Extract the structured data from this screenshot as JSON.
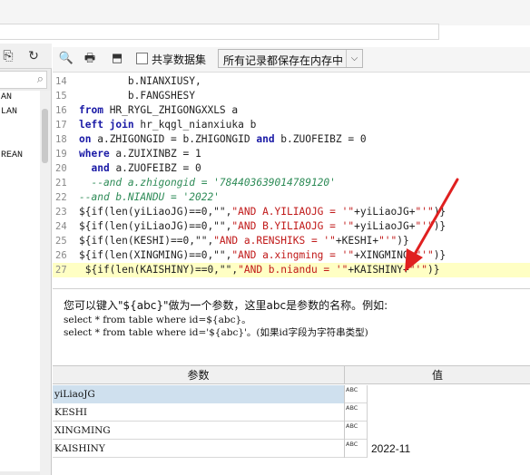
{
  "top_toolbar": {
    "left_icons": [
      {
        "name": "format-icon",
        "glyph": "⎘"
      },
      {
        "name": "refresh-icon",
        "glyph": "↻"
      }
    ],
    "search_icon": "⌕"
  },
  "left_list": {
    "items": [
      "AN",
      "LAN",
      "",
      "",
      "REAN"
    ]
  },
  "editor_toolbar": {
    "icons": [
      {
        "name": "preview-icon",
        "glyph": "🔍"
      },
      {
        "name": "print-icon",
        "glyph": "🖶"
      },
      {
        "name": "export-icon",
        "glyph": "⬒"
      }
    ],
    "share_label": "共享数据集",
    "storage_select": "所有记录都保存在内存中",
    "select_arrow": "⌵"
  },
  "editor": {
    "lines": [
      {
        "n": "14",
        "tokens": [
          {
            "t": "        b.NIANXIUSY,",
            "c": ""
          }
        ]
      },
      {
        "n": "15",
        "tokens": [
          {
            "t": "        b.FANGSHESY",
            "c": ""
          }
        ]
      },
      {
        "n": "16",
        "tokens": [
          {
            "t": "from",
            "c": "kw"
          },
          {
            "t": " HR_RYGL_ZHIGONGXXLS a",
            "c": ""
          }
        ]
      },
      {
        "n": "17",
        "tokens": [
          {
            "t": "left join",
            "c": "kw"
          },
          {
            "t": " hr_kqgl_nianxiuka b",
            "c": ""
          }
        ]
      },
      {
        "n": "18",
        "tokens": [
          {
            "t": "on",
            "c": "kw"
          },
          {
            "t": " a.ZHIGONGID = b.ZHIGONGID ",
            "c": ""
          },
          {
            "t": "and",
            "c": "kw"
          },
          {
            "t": " b.ZUOFEIBZ = 0",
            "c": ""
          }
        ]
      },
      {
        "n": "19",
        "tokens": [
          {
            "t": "where",
            "c": "kw"
          },
          {
            "t": " a.ZUIXINBZ = 1",
            "c": ""
          }
        ]
      },
      {
        "n": "20",
        "tokens": [
          {
            "t": "  ",
            "c": ""
          },
          {
            "t": "and",
            "c": "kw"
          },
          {
            "t": " a.ZUOFEIBZ = 0",
            "c": ""
          }
        ]
      },
      {
        "n": "21",
        "tokens": [
          {
            "t": "  --and a.zhigongid = '784403639014789120'",
            "c": "cm"
          }
        ]
      },
      {
        "n": "22",
        "tokens": [
          {
            "t": "--and b.NIANDU = '2022'",
            "c": "cm"
          }
        ]
      },
      {
        "n": "23",
        "tokens": [
          {
            "t": "${if(len(yiLiaoJG)==0,\"\",",
            "c": ""
          },
          {
            "t": "\"AND A.YILIAOJG = '\"",
            "c": "st"
          },
          {
            "t": "+yiLiaoJG+",
            "c": ""
          },
          {
            "t": "\"'\"",
            "c": "st"
          },
          {
            "t": ")}",
            "c": ""
          }
        ]
      },
      {
        "n": "24",
        "tokens": [
          {
            "t": "${if(len(yiLiaoJG)==0,\"\",",
            "c": ""
          },
          {
            "t": "\"AND B.YILIAOJG = '\"",
            "c": "st"
          },
          {
            "t": "+yiLiaoJG+",
            "c": ""
          },
          {
            "t": "\"'\"",
            "c": "st"
          },
          {
            "t": ")}",
            "c": ""
          }
        ]
      },
      {
        "n": "25",
        "tokens": [
          {
            "t": "${if(len(KESHI)==0,\"\",",
            "c": ""
          },
          {
            "t": "\"AND a.RENSHIKS = '\"",
            "c": "st"
          },
          {
            "t": "+KESHI+",
            "c": ""
          },
          {
            "t": "\"'\"",
            "c": "st"
          },
          {
            "t": ")}",
            "c": ""
          }
        ]
      },
      {
        "n": "26",
        "tokens": [
          {
            "t": "${if(len(XINGMING)==0,\"\",",
            "c": ""
          },
          {
            "t": "\"AND a.xingming = '\"",
            "c": "st"
          },
          {
            "t": "+XINGMING+",
            "c": ""
          },
          {
            "t": "\"'\"",
            "c": "st"
          },
          {
            "t": ")}",
            "c": ""
          }
        ]
      },
      {
        "n": "27",
        "tokens": [
          {
            "t": " ${if(len(KAISHINY)==0,\"\",",
            "c": ""
          },
          {
            "t": "\"AND b.niandu = '\"",
            "c": "st"
          },
          {
            "t": "+KAISHINY+",
            "c": ""
          },
          {
            "t": "\"'\"",
            "c": "st"
          },
          {
            "t": ")}",
            "c": ""
          }
        ]
      }
    ],
    "highlight_line": "27"
  },
  "help": {
    "line1": "您可以键入\"${abc}\"做为一个参数，这里abc是参数的名称。例如:",
    "line2": "select * from table where id=${abc}。",
    "line3": "select * from table where id='${abc}'。(如果id字段为字符串类型)"
  },
  "params": {
    "header_name": "参数",
    "header_value": "值",
    "type_icon": "ABC",
    "rows": [
      {
        "name": "yiLiaoJG",
        "value": ""
      },
      {
        "name": "KESHI",
        "value": ""
      },
      {
        "name": "XINGMING",
        "value": ""
      },
      {
        "name": "KAISHINY",
        "value": "2022-11"
      }
    ]
  },
  "colors": {
    "keyword": "#1a1aa6",
    "comment": "#2e8b57",
    "string": "#c01818",
    "highlight": "#ffffc4",
    "annotation_arrow": "#e02020"
  }
}
